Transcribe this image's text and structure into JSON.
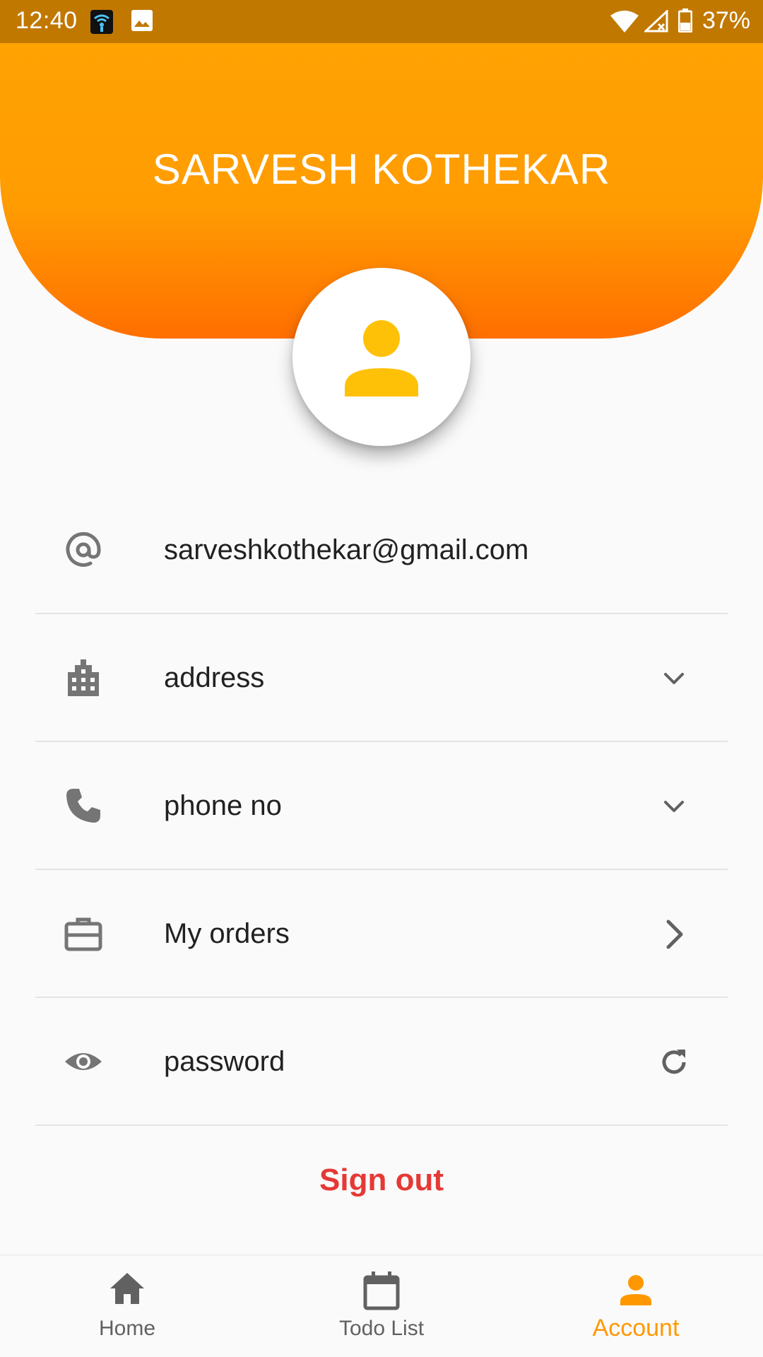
{
  "status_bar": {
    "time": "12:40",
    "battery": "37%"
  },
  "profile": {
    "name": "SARVESH KOTHEKAR"
  },
  "rows": [
    {
      "icon": "at-sign-icon",
      "label": "sarveshkothekar@gmail.com"
    },
    {
      "icon": "building-icon",
      "label": "address",
      "trailing": "chevron-down-icon"
    },
    {
      "icon": "phone-icon",
      "label": "phone no",
      "trailing": "chevron-down-icon"
    },
    {
      "icon": "briefcase-icon",
      "label": "My orders",
      "trailing": "chevron-right-icon"
    },
    {
      "icon": "eye-icon",
      "label": "password",
      "trailing": "refresh-icon"
    }
  ],
  "sign_out": "Sign out",
  "bottom_nav": {
    "items": [
      {
        "label": "Home",
        "icon": "home-icon"
      },
      {
        "label": "Todo List",
        "icon": "calendar-icon"
      },
      {
        "label": "Account",
        "icon": "person-icon",
        "active": true
      }
    ]
  },
  "colors": {
    "status_bar": "#c17800",
    "header_top": "#ffa202",
    "header_bottom": "#ff6f00",
    "avatar_icon": "#ffc107",
    "sign_out": "#e53935",
    "nav_active": "#ff9800",
    "icon_grey": "#757575"
  }
}
